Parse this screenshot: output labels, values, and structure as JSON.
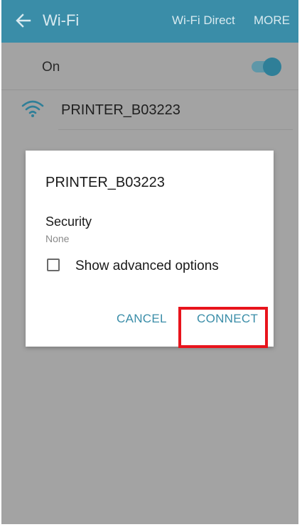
{
  "header": {
    "title": "Wi-Fi",
    "wifi_direct_label": "Wi-Fi Direct",
    "more_label": "MORE"
  },
  "wifi_toggle": {
    "label": "On",
    "state": true
  },
  "networks": [
    {
      "ssid": "PRINTER_B03223"
    }
  ],
  "dialog": {
    "title": "PRINTER_B03223",
    "security_label": "Security",
    "security_value": "None",
    "advanced_label": "Show advanced options",
    "advanced_checked": false,
    "cancel_label": "CANCEL",
    "connect_label": "CONNECT"
  },
  "colors": {
    "accent": "#3a8da8",
    "highlight": "#e8141c",
    "dim_background": "#a3a3a3"
  },
  "icons": [
    "back-arrow-icon",
    "wifi-signal-icon",
    "checkbox-icon"
  ]
}
